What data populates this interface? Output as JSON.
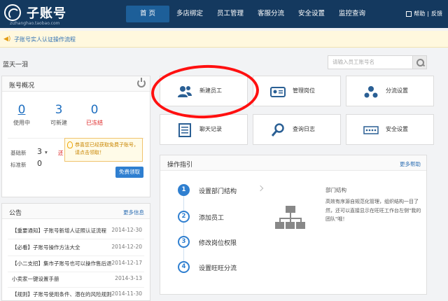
{
  "header": {
    "logo_title": "子账号",
    "logo_subtitle": "zizhanghao.taobao.com",
    "nav": [
      {
        "label": "首 页",
        "active": true
      },
      {
        "label": "多店绑定",
        "active": false
      },
      {
        "label": "员工管理",
        "active": false
      },
      {
        "label": "客服分流",
        "active": false
      },
      {
        "label": "安全设置",
        "active": false
      },
      {
        "label": "监控查询",
        "active": false
      }
    ],
    "help_label": "帮助",
    "feedback_label": "反馈"
  },
  "notice": {
    "text": "子账号实人认证操作流程"
  },
  "user": {
    "name": "蓝天一泪"
  },
  "search": {
    "placeholder": "请输入员工账号名"
  },
  "account_overview": {
    "title": "账号概况",
    "stats": [
      {
        "value": "0",
        "label": "使用中"
      },
      {
        "value": "3",
        "label": "可新建"
      },
      {
        "value": "0",
        "label": "已冻结"
      }
    ],
    "basic_label": "基础新",
    "basic_value": "3",
    "basic_extra": "还",
    "standard_label": "标准新",
    "standard_value": "0",
    "tooltip_text": "恭喜您已经获取免费子账号，请点击领取！",
    "claim_button": "免费领取"
  },
  "announcements": {
    "title": "公告",
    "more": "更多信息",
    "items": [
      {
        "title": "【重要通知】子账号新增人证照认证流程",
        "date": "2014-12-30"
      },
      {
        "title": "【必看】子账号操作方法大全",
        "date": "2014-12-20"
      },
      {
        "title": "【小二支招】集市子账号也可以操作售后退",
        "date": "2014-12-17"
      },
      {
        "title": "小卖家一键设置手册",
        "date": "2014-3-13"
      },
      {
        "title": "【规则】子账号使用条件、潜在的风险规则",
        "date": "2014-11-30"
      }
    ]
  },
  "tiles": [
    {
      "label": "新建员工",
      "icon": "users-icon"
    },
    {
      "label": "管理岗位",
      "icon": "id-card-icon"
    },
    {
      "label": "分流设置",
      "icon": "dispatch-icon"
    },
    {
      "label": "聊天记录",
      "icon": "document-icon"
    },
    {
      "label": "查询日志",
      "icon": "magnifier-icon"
    },
    {
      "label": "安全设置",
      "icon": "password-icon"
    }
  ],
  "guide": {
    "title": "操作指引",
    "more": "更多帮助",
    "steps": [
      {
        "num": "1",
        "label": "设置部门结构"
      },
      {
        "num": "2",
        "label": "添加员工"
      },
      {
        "num": "3",
        "label": "修改岗位权限"
      },
      {
        "num": "4",
        "label": "设置旺旺分流"
      }
    ],
    "detail_title": "部门结构",
    "detail_text": "高效有序源自规范化管理，组织结构一目了然，还可以直接显示在旺旺工作台左侧\"我的团队\"哦！"
  },
  "colors": {
    "header_bg": "#14395f",
    "nav_active": "#1d5f99",
    "accent": "#2f7fd0",
    "highlight_ellipse": "#ff1010"
  }
}
